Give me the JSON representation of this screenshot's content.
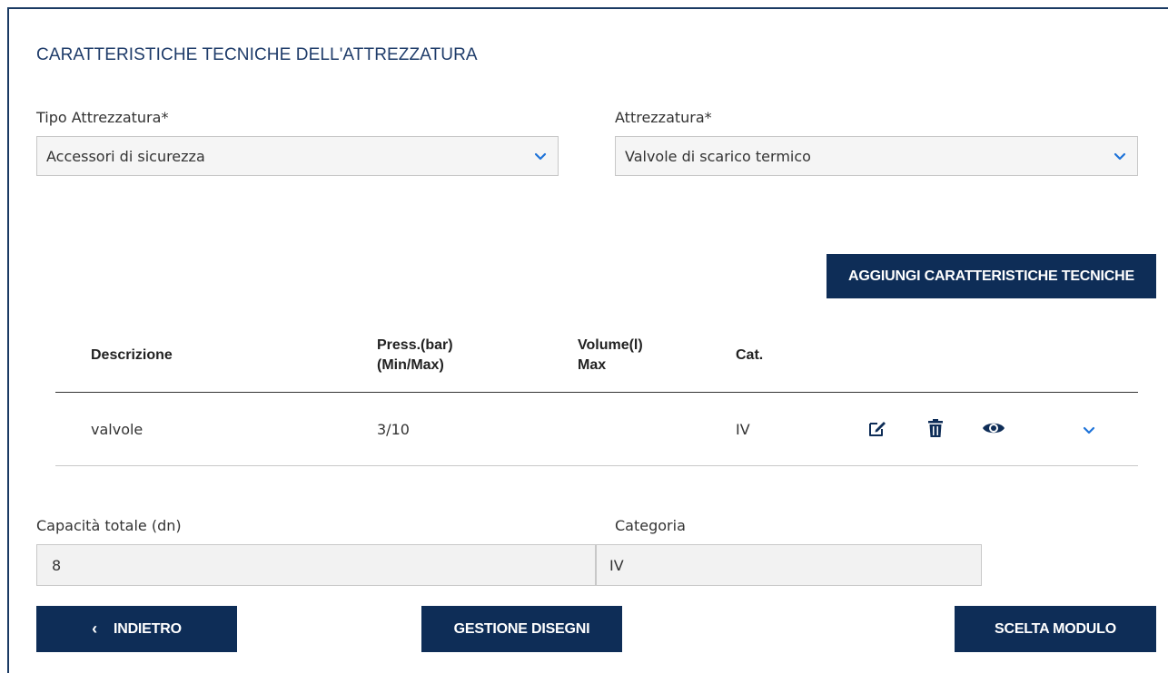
{
  "section_title": "CARATTERISTICHE TECNICHE DELL'ATTREZZATURA",
  "tipo": {
    "label": "Tipo Attrezzatura*",
    "value": "Accessori di sicurezza"
  },
  "attrezzatura": {
    "label": "Attrezzatura*",
    "value": "Valvole di scarico termico"
  },
  "add_button": "AGGIUNGI CARATTERISTICHE TECNICHE",
  "table": {
    "headers": {
      "descrizione": "Descrizione",
      "press_line1": "Press.(bar)",
      "press_line2": "(Min/Max)",
      "volume_line1": "Volume(l)",
      "volume_line2": "Max",
      "cat": "Cat."
    },
    "rows": [
      {
        "descrizione": "valvole",
        "press": "3/10",
        "volume": "",
        "cat": "IV"
      }
    ]
  },
  "capacita": {
    "label": "Capacità totale (dn)",
    "value": "8"
  },
  "categoria": {
    "label": "Categoria",
    "value": "IV"
  },
  "buttons": {
    "back": "INDIETRO",
    "back_glyph": "‹",
    "disegni": "GESTIONE DISEGNI",
    "modulo": "SCELTA MODULO"
  },
  "colors": {
    "primary": "#0e2d57",
    "accent": "#1e73d9"
  },
  "icons": [
    "chevron-down-icon",
    "edit-icon",
    "trash-icon",
    "eye-icon",
    "chevron-left-icon"
  ]
}
